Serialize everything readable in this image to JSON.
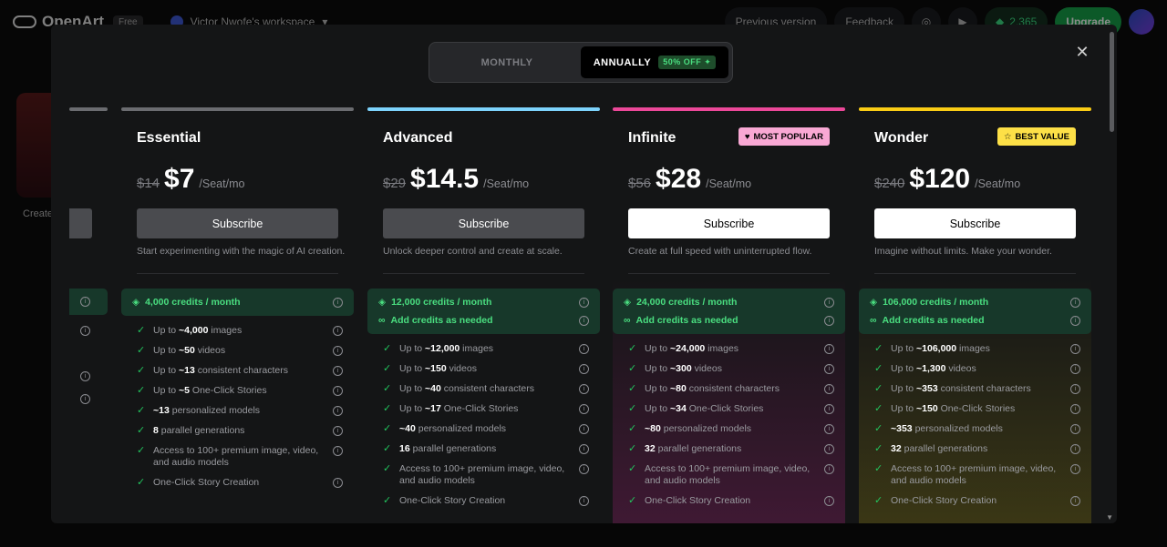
{
  "topbar": {
    "brand": "OpenArt",
    "plan_badge": "Free",
    "workspace": "Victor Nwofe's workspace",
    "previous_version": "Previous version",
    "feedback": "Feedback",
    "credits": "2,365",
    "upgrade": "Upgrade"
  },
  "background": {
    "create_label": "Create"
  },
  "billing_toggle": {
    "monthly": "MONTHLY",
    "annually": "ANNUALLY",
    "discount": "50% OFF"
  },
  "plans": [
    {
      "name": "Essential",
      "badge": "",
      "old_price": "$14",
      "price": "$7",
      "per": "/Seat/mo",
      "subscribe": "Subscribe",
      "description": "Start experimenting with the magic of AI creation.",
      "credits": "4,000 credits / month",
      "add_credits": "",
      "features": [
        {
          "pre": "Up to ",
          "val": "~4,000",
          "post": " images"
        },
        {
          "pre": "Up to ",
          "val": "~50",
          "post": " videos"
        },
        {
          "pre": "Up to ",
          "val": "~13",
          "post": " consistent characters"
        },
        {
          "pre": "Up to ",
          "val": "~5",
          "post": " One-Click Stories"
        },
        {
          "pre": "",
          "val": "~13",
          "post": " personalized models"
        },
        {
          "pre": "",
          "val": "8",
          "post": " parallel generations"
        },
        {
          "pre": "Access to 100+ premium image, video, and audio models",
          "val": "",
          "post": ""
        },
        {
          "pre": "One-Click Story Creation",
          "val": "",
          "post": ""
        }
      ]
    },
    {
      "name": "Advanced",
      "badge": "",
      "old_price": "$29",
      "price": "$14.5",
      "per": "/Seat/mo",
      "subscribe": "Subscribe",
      "description": "Unlock deeper control and create at scale.",
      "credits": "12,000 credits / month",
      "add_credits": "Add credits as needed",
      "features": [
        {
          "pre": "Up to ",
          "val": "~12,000",
          "post": " images"
        },
        {
          "pre": "Up to ",
          "val": "~150",
          "post": " videos"
        },
        {
          "pre": "Up to ",
          "val": "~40",
          "post": " consistent characters"
        },
        {
          "pre": "Up to ",
          "val": "~17",
          "post": " One-Click Stories"
        },
        {
          "pre": "",
          "val": "~40",
          "post": " personalized models"
        },
        {
          "pre": "",
          "val": "16",
          "post": " parallel generations"
        },
        {
          "pre": "Access to 100+ premium image, video, and audio models",
          "val": "",
          "post": ""
        },
        {
          "pre": "One-Click Story Creation",
          "val": "",
          "post": ""
        }
      ]
    },
    {
      "name": "Infinite",
      "badge": "MOST POPULAR",
      "old_price": "$56",
      "price": "$28",
      "per": "/Seat/mo",
      "subscribe": "Subscribe",
      "description": "Create at full speed with uninterrupted flow.",
      "credits": "24,000 credits / month",
      "add_credits": "Add credits as needed",
      "features": [
        {
          "pre": "Up to ",
          "val": "~24,000",
          "post": " images"
        },
        {
          "pre": "Up to ",
          "val": "~300",
          "post": " videos"
        },
        {
          "pre": "Up to ",
          "val": "~80",
          "post": " consistent characters"
        },
        {
          "pre": "Up to ",
          "val": "~34",
          "post": " One-Click Stories"
        },
        {
          "pre": "",
          "val": "~80",
          "post": " personalized models"
        },
        {
          "pre": "",
          "val": "32",
          "post": " parallel generations"
        },
        {
          "pre": "Access to 100+ premium image, video, and audio models",
          "val": "",
          "post": ""
        },
        {
          "pre": "One-Click Story Creation",
          "val": "",
          "post": ""
        }
      ]
    },
    {
      "name": "Wonder",
      "badge": "BEST VALUE",
      "old_price": "$240",
      "price": "$120",
      "per": "/Seat/mo",
      "subscribe": "Subscribe",
      "description": "Imagine without limits. Make your wonder.",
      "credits": "106,000 credits / month",
      "add_credits": "Add credits as needed",
      "features": [
        {
          "pre": "Up to ",
          "val": "~106,000",
          "post": " images"
        },
        {
          "pre": "Up to ",
          "val": "~1,300",
          "post": " videos"
        },
        {
          "pre": "Up to ",
          "val": "~353",
          "post": " consistent characters"
        },
        {
          "pre": "Up to ",
          "val": "~150",
          "post": " One-Click Stories"
        },
        {
          "pre": "",
          "val": "~353",
          "post": " personalized models"
        },
        {
          "pre": "",
          "val": "32",
          "post": " parallel generations"
        },
        {
          "pre": "Access to 100+ premium image, video, and audio models",
          "val": "",
          "post": ""
        },
        {
          "pre": "One-Click Story Creation",
          "val": "",
          "post": ""
        }
      ]
    }
  ],
  "colors": {
    "essential_line": "#6b6c70",
    "advanced_line": "#7dd3fc",
    "infinite_line": "#ec4899",
    "wonder_line": "#facc15",
    "popular_badge": "#f9a8d4",
    "best_value_badge": "#fde047",
    "credit_green": "#4ade80"
  }
}
